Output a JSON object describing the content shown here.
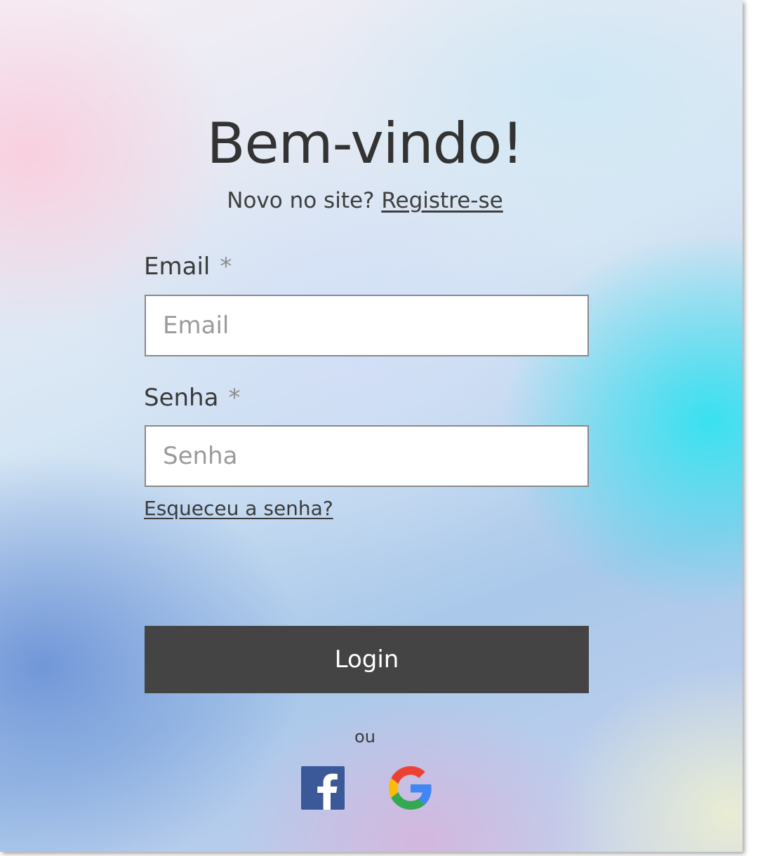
{
  "page": {
    "title": "Bem-vindo!",
    "subtitle_text": "Novo no site?",
    "register_link": "Registre-se"
  },
  "form": {
    "email": {
      "label": "Email",
      "required_mark": "*",
      "placeholder": "Email",
      "value": ""
    },
    "password": {
      "label": "Senha",
      "required_mark": "*",
      "placeholder": "Senha",
      "value": ""
    },
    "forgot_link": "Esqueceu a senha?",
    "login_label": "Login",
    "divider_text": "ou"
  },
  "social": {
    "facebook_icon": "facebook-icon",
    "google_icon": "google-icon",
    "facebook_color": "#3b5998"
  },
  "colors": {
    "button_bg": "#444444",
    "text": "#333333"
  }
}
